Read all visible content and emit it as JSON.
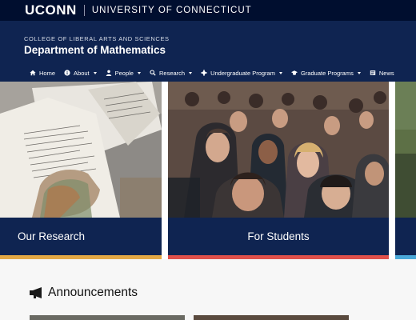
{
  "topbar": {
    "logo": "UCONN",
    "university": "UNIVERSITY OF CONNECTICUT"
  },
  "header": {
    "college": "COLLEGE OF LIBERAL ARTS AND SCIENCES",
    "department": "Department of Mathematics"
  },
  "nav": {
    "items": [
      {
        "label": "Home",
        "icon": "home-icon",
        "dropdown": false
      },
      {
        "label": "About",
        "icon": "info-icon",
        "dropdown": true
      },
      {
        "label": "People",
        "icon": "person-icon",
        "dropdown": true
      },
      {
        "label": "Research",
        "icon": "search-icon",
        "dropdown": true
      },
      {
        "label": "Undergraduate Program",
        "icon": "undergrad-icon",
        "dropdown": true
      },
      {
        "label": "Graduate Programs",
        "icon": "graduation-cap-icon",
        "dropdown": true
      },
      {
        "label": "News",
        "icon": "newspaper-icon",
        "dropdown": false
      }
    ]
  },
  "tiles": [
    {
      "label": "Our Research",
      "stripe_color": "#e3a845",
      "image": "research-papers-photo"
    },
    {
      "label": "For Students",
      "stripe_color": "#e0504a",
      "image": "students-lecture-photo"
    },
    {
      "label": "",
      "stripe_color": "#4aa8d8",
      "image": "campus-photo"
    }
  ],
  "announcements": {
    "title": "Announcements",
    "icon": "megaphone-icon"
  },
  "colors": {
    "topbar": "#000e2f",
    "header": "#0f2451",
    "tile_label": "#0f2451"
  }
}
